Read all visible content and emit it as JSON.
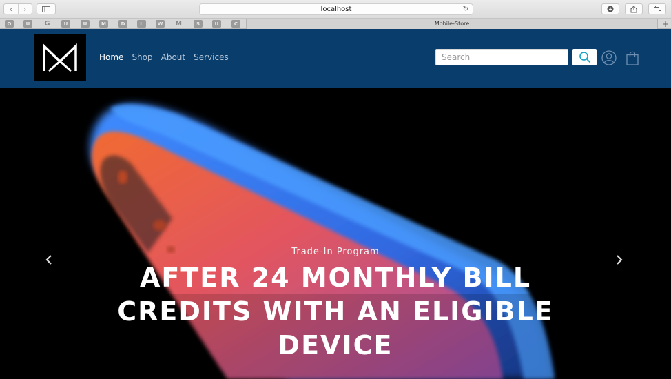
{
  "browser": {
    "url": "localhost",
    "tab_title": "Mobile-Store",
    "favorites": [
      "O",
      "U",
      "G",
      "U",
      "U",
      "M",
      "D",
      "L",
      "W",
      "M",
      "S",
      "U",
      "C"
    ]
  },
  "site": {
    "nav": [
      {
        "label": "Home",
        "active": true
      },
      {
        "label": "Shop",
        "active": false
      },
      {
        "label": "About",
        "active": false
      },
      {
        "label": "Services",
        "active": false
      }
    ],
    "search_placeholder": "Search",
    "header_color": "#093d6c"
  },
  "hero": {
    "subtitle": "Trade-In Program",
    "title": "AFTER 24 MONTHLY BILL CREDITS WITH AN ELIGIBLE DEVICE",
    "prev_icon": "chevron-left-icon",
    "next_icon": "chevron-right-icon"
  }
}
